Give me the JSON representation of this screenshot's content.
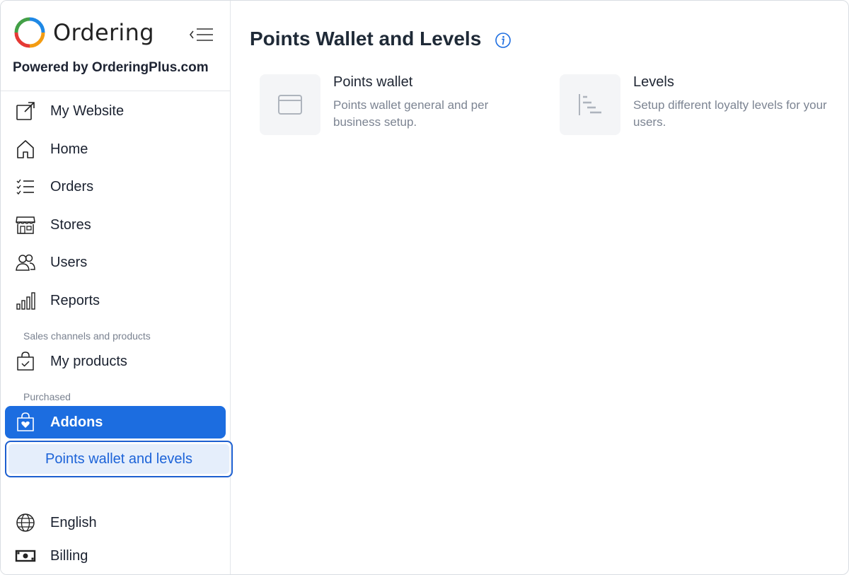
{
  "brand": {
    "name": "Ordering",
    "powered_by": "Powered by OrderingPlus.com"
  },
  "sidebar": {
    "items": [
      {
        "label": "My Website",
        "icon": "external-link-icon"
      },
      {
        "label": "Home",
        "icon": "home-icon"
      },
      {
        "label": "Orders",
        "icon": "list-check-icon"
      },
      {
        "label": "Stores",
        "icon": "store-icon"
      },
      {
        "label": "Users",
        "icon": "users-icon"
      },
      {
        "label": "Reports",
        "icon": "bar-chart-icon"
      }
    ],
    "section_sales": "Sales channels and products",
    "my_products": {
      "label": "My products",
      "icon": "bag-check-icon"
    },
    "section_purchased": "Purchased",
    "addons": {
      "label": "Addons",
      "icon": "bag-heart-icon"
    },
    "addons_sub": {
      "label": "Points wallet and levels"
    },
    "language": {
      "label": "English",
      "icon": "globe-icon"
    },
    "billing": {
      "label": "Billing",
      "icon": "cash-icon"
    }
  },
  "main": {
    "title": "Points Wallet and Levels",
    "cards": [
      {
        "title": "Points wallet",
        "description": "Points wallet general and per business setup.",
        "icon": "wallet-icon"
      },
      {
        "title": "Levels",
        "description": "Setup different loyalty levels for your users.",
        "icon": "levels-icon"
      }
    ]
  },
  "colors": {
    "accent": "#1c6de0",
    "sub_bg": "#e5eefb",
    "sub_text": "#1c63d8"
  }
}
